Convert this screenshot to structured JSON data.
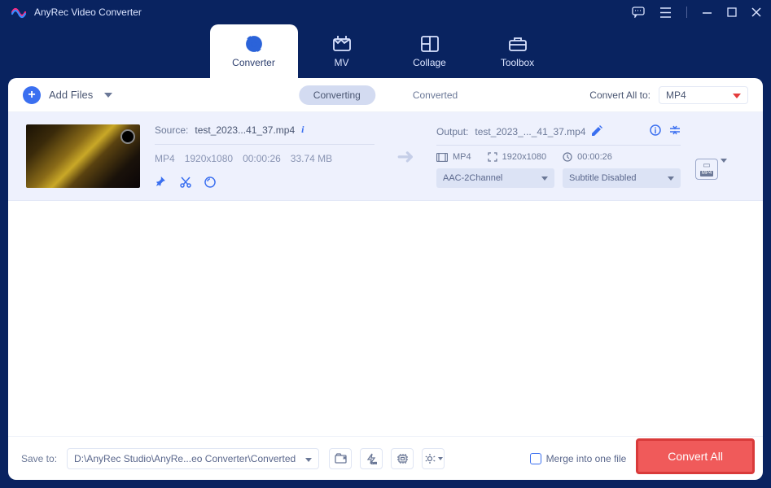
{
  "app": {
    "title": "AnyRec Video Converter"
  },
  "tabs": {
    "converter": "Converter",
    "mv": "MV",
    "collage": "Collage",
    "toolbox": "Toolbox"
  },
  "toolbar": {
    "add_files": "Add Files",
    "converting": "Converting",
    "converted": "Converted",
    "convert_all_to": "Convert All to:",
    "format": "MP4"
  },
  "file": {
    "source_label": "Source:",
    "source_name": "test_2023...41_37.mp4",
    "format": "MP4",
    "resolution": "1920x1080",
    "duration": "00:00:26",
    "size": "33.74 MB",
    "output_label": "Output:",
    "output_name": "test_2023_..._41_37.mp4",
    "out_format": "MP4",
    "out_resolution": "1920x1080",
    "out_duration": "00:00:26",
    "audio_select": "AAC-2Channel",
    "subtitle_select": "Subtitle Disabled",
    "fmt_badge": "MP4"
  },
  "footer": {
    "save_to": "Save to:",
    "path": "D:\\AnyRec Studio\\AnyRe...eo Converter\\Converted",
    "merge": "Merge into one file",
    "convert_all": "Convert All"
  }
}
